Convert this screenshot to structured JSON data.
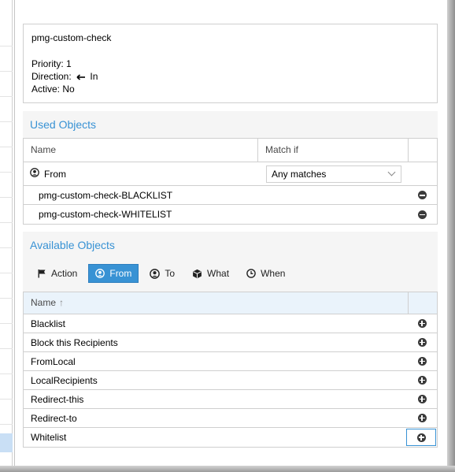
{
  "rule": {
    "name": "pmg-custom-check",
    "priority": "Priority: 1",
    "direction_label": "Direction:",
    "direction_value": "In",
    "active": "Active: No"
  },
  "used_objects": {
    "title": "Used Objects",
    "columns": {
      "name": "Name",
      "match_if": "Match if"
    },
    "group": {
      "label": "From",
      "match_value": "Any matches"
    },
    "items": [
      {
        "name": "pmg-custom-check-BLACKLIST"
      },
      {
        "name": "pmg-custom-check-WHITELIST"
      }
    ]
  },
  "available_objects": {
    "title": "Available Objects",
    "tabs": [
      {
        "label": "Action",
        "icon": "flag-icon",
        "active": false
      },
      {
        "label": "From",
        "icon": "user-circle-icon",
        "active": true
      },
      {
        "label": "To",
        "icon": "user-circle-icon",
        "active": false
      },
      {
        "label": "What",
        "icon": "cube-icon",
        "active": false
      },
      {
        "label": "When",
        "icon": "clock-icon",
        "active": false
      }
    ],
    "columns": {
      "name": "Name",
      "sort_indicator": "↑"
    },
    "items": [
      {
        "name": "Blacklist"
      },
      {
        "name": "Block this Recipients"
      },
      {
        "name": "FromLocal"
      },
      {
        "name": "LocalRecipients"
      },
      {
        "name": "Redirect-this"
      },
      {
        "name": "Redirect-to"
      },
      {
        "name": "Whitelist"
      }
    ]
  },
  "colors": {
    "accent": "#3892d4",
    "header_tint": "#eaf3fb",
    "section_bg": "#f5f5f5",
    "border": "#cfcfcf"
  }
}
